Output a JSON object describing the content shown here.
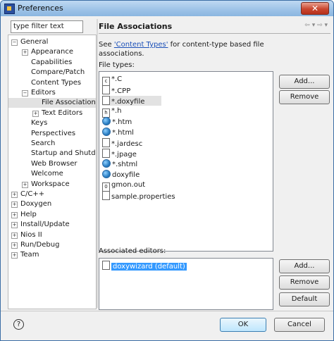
{
  "window": {
    "title": "Preferences",
    "close_glyph": "✕"
  },
  "left": {
    "filter_value": "type filter text",
    "tree": [
      {
        "label": "General",
        "depth": 0,
        "toggle": "−"
      },
      {
        "label": "Appearance",
        "depth": 1,
        "toggle": "+"
      },
      {
        "label": "Capabilities",
        "depth": 1,
        "toggle": ""
      },
      {
        "label": "Compare/Patch",
        "depth": 1,
        "toggle": ""
      },
      {
        "label": "Content Types",
        "depth": 1,
        "toggle": ""
      },
      {
        "label": "Editors",
        "depth": 1,
        "toggle": "−"
      },
      {
        "label": "File Associations",
        "depth": 2,
        "toggle": "",
        "selected": true
      },
      {
        "label": "Text Editors",
        "depth": 2,
        "toggle": "+"
      },
      {
        "label": "Keys",
        "depth": 1,
        "toggle": ""
      },
      {
        "label": "Perspectives",
        "depth": 1,
        "toggle": ""
      },
      {
        "label": "Search",
        "depth": 1,
        "toggle": ""
      },
      {
        "label": "Startup and Shutdown",
        "depth": 1,
        "toggle": ""
      },
      {
        "label": "Web Browser",
        "depth": 1,
        "toggle": ""
      },
      {
        "label": "Welcome",
        "depth": 1,
        "toggle": ""
      },
      {
        "label": "Workspace",
        "depth": 1,
        "toggle": "+"
      },
      {
        "label": "C/C++",
        "depth": 0,
        "toggle": "+"
      },
      {
        "label": "Doxygen",
        "depth": 0,
        "toggle": "+"
      },
      {
        "label": "Help",
        "depth": 0,
        "toggle": "+"
      },
      {
        "label": "Install/Update",
        "depth": 0,
        "toggle": "+"
      },
      {
        "label": "Nios II",
        "depth": 0,
        "toggle": "+"
      },
      {
        "label": "Run/Debug",
        "depth": 0,
        "toggle": "+"
      },
      {
        "label": "Team",
        "depth": 0,
        "toggle": "+"
      }
    ]
  },
  "page": {
    "title": "File Associations",
    "nav_glyphs": "⇦ ▾ ⇨ ▾",
    "desc_prefix": "See ",
    "desc_link": "'Content Types'",
    "desc_suffix": " for content-type based file associations.",
    "file_types_label": "File types:",
    "file_types": [
      {
        "name": "*.C",
        "icon": "c-file-icon"
      },
      {
        "name": "*.CPP",
        "icon": "file-icon"
      },
      {
        "name": "*.doxyfile",
        "icon": "file-icon",
        "selected": true
      },
      {
        "name": "*.h",
        "icon": "h-file-icon"
      },
      {
        "name": "*.htm",
        "icon": "globe-icon"
      },
      {
        "name": "*.html",
        "icon": "globe-icon"
      },
      {
        "name": "*.jardesc",
        "icon": "file-icon"
      },
      {
        "name": "*.jpage",
        "icon": "file-icon"
      },
      {
        "name": "*.shtml",
        "icon": "globe-icon"
      },
      {
        "name": "doxyfile",
        "icon": "globe-icon"
      },
      {
        "name": "gmon.out",
        "icon": "gmon-icon"
      },
      {
        "name": "sample.properties",
        "icon": "file-icon"
      }
    ],
    "ft_add": "Add...",
    "ft_remove": "Remove",
    "assoc_label": "Associated editors:",
    "editors": [
      {
        "name": "doxywizard (default)",
        "selected": true
      }
    ],
    "ed_add": "Add...",
    "ed_remove": "Remove",
    "ed_default": "Default"
  },
  "footer": {
    "help": "?",
    "ok": "OK",
    "cancel": "Cancel"
  }
}
